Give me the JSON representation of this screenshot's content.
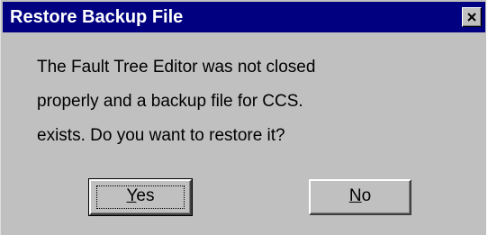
{
  "dialog": {
    "title": "Restore Backup File",
    "close_symbol": "✕",
    "message_lines": [
      "The Fault Tree Editor was not closed",
      "properly and a backup file for CCS.",
      "exists.  Do you want to restore it?"
    ],
    "buttons": {
      "yes": {
        "mnemonic": "Y",
        "rest": "es"
      },
      "no": {
        "mnemonic": "N",
        "rest": "o"
      }
    }
  },
  "colors": {
    "titlebar": "#000080",
    "face": "#c0c0c0",
    "title_text": "#ffffff"
  },
  "icons": {
    "close": "close-icon"
  }
}
